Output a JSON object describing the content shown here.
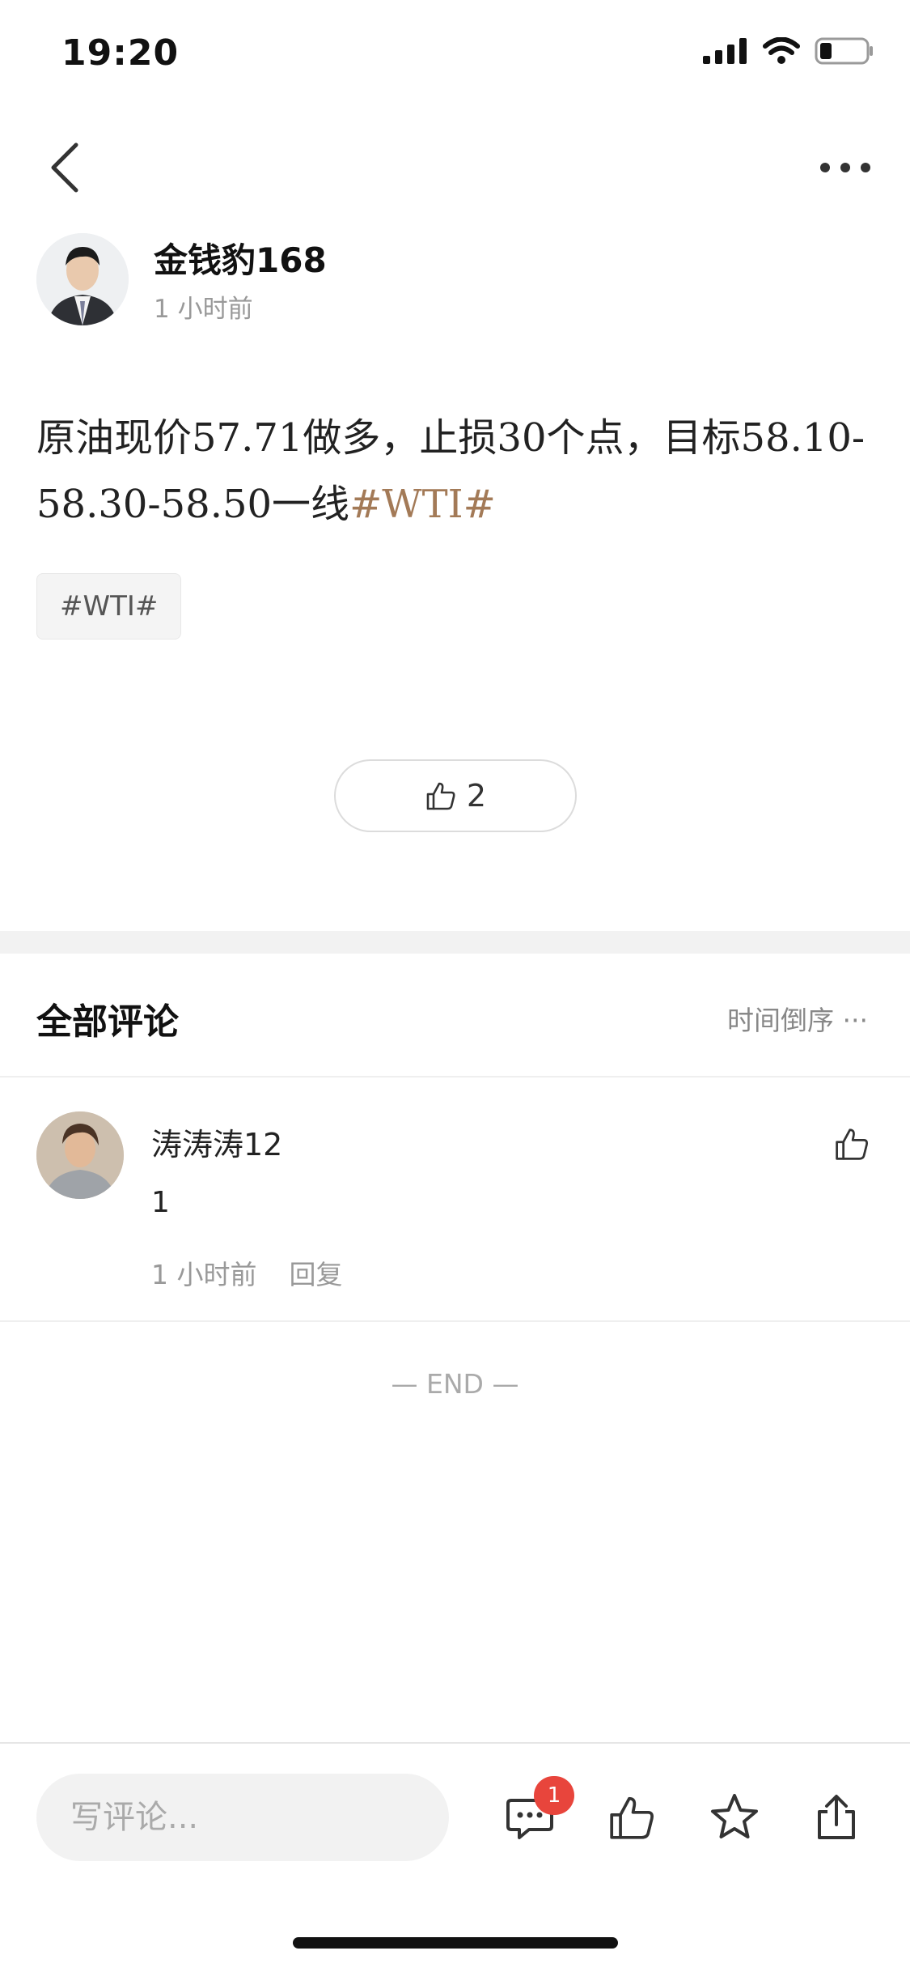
{
  "status_bar": {
    "time": "19:20",
    "icons": [
      "signal-icon",
      "wifi-icon",
      "battery-icon"
    ]
  },
  "nav": {
    "back_icon": "chevron-left-icon",
    "more_icon": "ellipsis-icon"
  },
  "post": {
    "author_name": "金钱豹168",
    "time_ago": "1 小时前",
    "content_text": "原油现价57.71做多，止损30个点，目标58.10-58.30-58.50一线",
    "content_hashtag": "#WTI#",
    "tag": "#WTI#",
    "like_count": "2"
  },
  "comments": {
    "title": "全部评论",
    "sort_label": "时间倒序 ···",
    "items": [
      {
        "user": "涛涛涛12",
        "text": "1",
        "time_ago": "1 小时前",
        "reply_label": "回复"
      }
    ],
    "end_label": "— END —"
  },
  "bottom_bar": {
    "input_placeholder": "写评论...",
    "comment_badge": "1",
    "icons": [
      "comment-icon",
      "thumbs-up-icon",
      "star-icon",
      "share-icon"
    ]
  },
  "colors": {
    "hashtag": "#a37a57",
    "badge": "#e8453c",
    "muted_text": "#999999",
    "divider": "#efefef"
  }
}
